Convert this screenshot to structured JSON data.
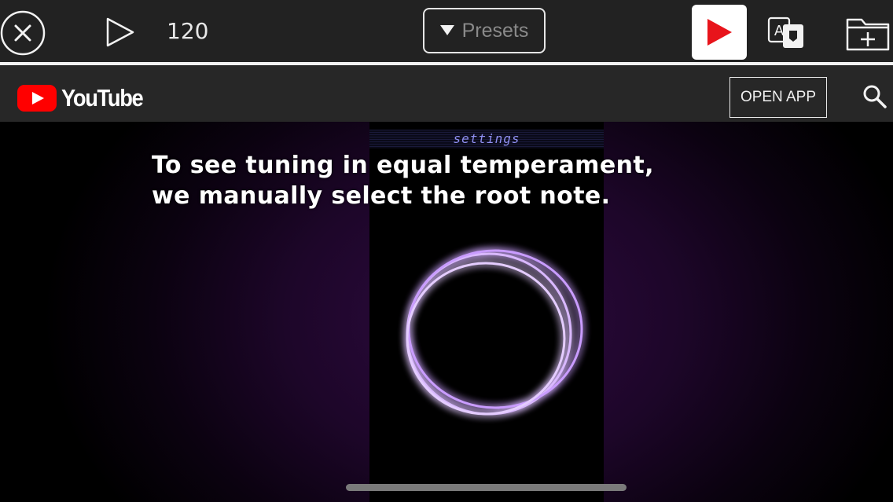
{
  "toolbar": {
    "tempo": "120",
    "presets_label": "Presets"
  },
  "youtube": {
    "brand": "YouTube",
    "open_app_label": "OPEN APP"
  },
  "video": {
    "settings_label": "settings",
    "caption_line1": "To see tuning in equal temperament,",
    "caption_line2": "we manually select the root note."
  },
  "colors": {
    "toolbar_bg": "#222222",
    "youtube_header_bg": "#272727",
    "youtube_red": "#ff0000",
    "ring_glow": "#c89bff",
    "video_purple": "#2e0a40"
  }
}
